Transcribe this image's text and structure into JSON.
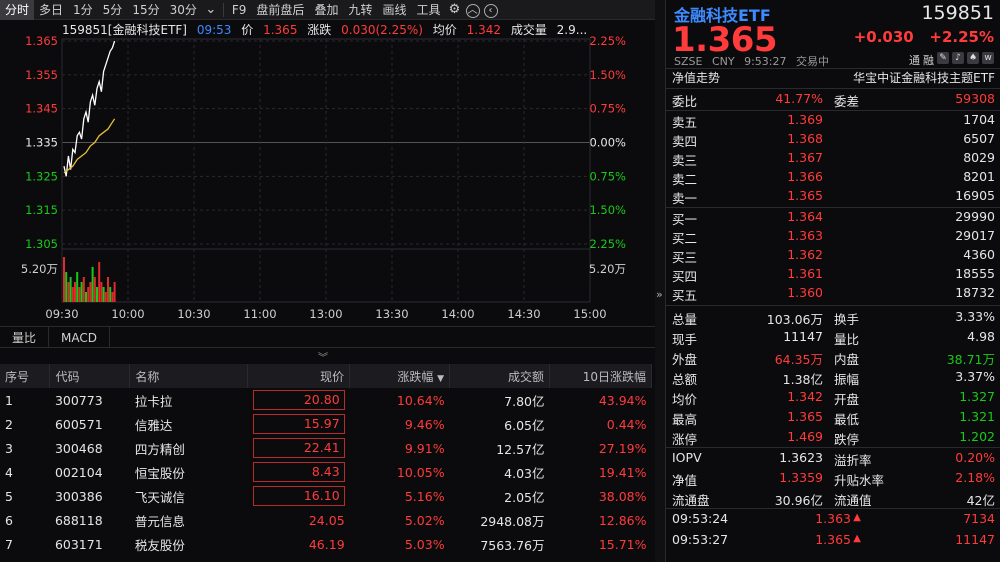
{
  "toolbar": {
    "left_tabs": [
      "分时",
      "多日",
      "1分",
      "5分",
      "15分",
      "30分"
    ],
    "right_tabs": [
      "F9",
      "盘前盘后",
      "叠加",
      "九转",
      "画线",
      "工具"
    ]
  },
  "chart_header": {
    "code_name": "159851[金融科技ETF]",
    "time": "09:53",
    "price_label": "价",
    "price": "1.365",
    "change_label": "涨跌",
    "change": "0.030(2.25%)",
    "avg_label": "均价",
    "avg": "1.342",
    "vol_label": "成交量",
    "vol": "2.9..."
  },
  "chart_data": {
    "type": "line",
    "x_ticks": [
      "09:30",
      "10:00",
      "10:30",
      "11:00",
      "13:00",
      "13:30",
      "14:00",
      "14:30",
      "15:00"
    ],
    "y_ticks_left": [
      "1.365",
      "1.355",
      "1.345",
      "1.335",
      "1.325",
      "1.315",
      "1.305"
    ],
    "y_ticks_right": [
      "2.25%",
      "1.50%",
      "0.75%",
      "0.00%",
      "0.75%",
      "1.50%",
      "2.25%"
    ],
    "ylim": [
      1.305,
      1.365
    ],
    "prev_close": 1.335,
    "volume_tick": "5.20万",
    "series": [
      {
        "name": "价",
        "color": "#ffffff",
        "x": [
          0,
          1,
          2,
          3,
          4,
          5,
          6,
          7,
          8,
          9,
          10,
          11,
          12,
          13,
          14,
          15,
          16,
          17,
          18,
          19,
          20,
          21,
          22,
          23
        ],
        "y": [
          1.328,
          1.325,
          1.331,
          1.327,
          1.333,
          1.332,
          1.337,
          1.338,
          1.336,
          1.342,
          1.344,
          1.341,
          1.347,
          1.349,
          1.346,
          1.351,
          1.353,
          1.35,
          1.356,
          1.358,
          1.36,
          1.362,
          1.363,
          1.365
        ]
      },
      {
        "name": "均价",
        "color": "#e8c13a",
        "x": [
          0,
          2,
          4,
          6,
          8,
          10,
          12,
          14,
          16,
          18,
          20,
          22,
          23
        ],
        "y": [
          1.326,
          1.327,
          1.328,
          1.33,
          1.331,
          1.332,
          1.334,
          1.335,
          1.337,
          1.338,
          1.339,
          1.341,
          1.342
        ]
      }
    ],
    "volume": [
      9,
      6,
      4,
      5,
      3,
      4,
      6,
      3,
      4,
      5,
      2,
      3,
      4,
      7,
      5,
      3,
      8,
      4,
      3,
      2,
      5,
      3,
      2,
      4
    ],
    "volume_colors": [
      "r",
      "g",
      "r",
      "g",
      "r",
      "r",
      "g",
      "r",
      "g",
      "r",
      "g",
      "r",
      "r",
      "g",
      "r",
      "g",
      "r",
      "r",
      "g",
      "r",
      "r",
      "g",
      "r",
      "r"
    ]
  },
  "subtabs": [
    "量比",
    "MACD"
  ],
  "table": {
    "headers": [
      "序号",
      "代码",
      "名称",
      "现价",
      "涨跌幅",
      "成交额",
      "10日涨跌幅"
    ],
    "rows": [
      {
        "no": "1",
        "code": "300773",
        "name": "拉卡拉",
        "price": "20.80",
        "chg": "10.64%",
        "amount": "7.80亿",
        "chg10": "43.94%",
        "boxed": true
      },
      {
        "no": "2",
        "code": "600571",
        "name": "信雅达",
        "price": "15.97",
        "chg": "9.46%",
        "amount": "6.05亿",
        "chg10": "0.44%",
        "boxed": true
      },
      {
        "no": "3",
        "code": "300468",
        "name": "四方精创",
        "price": "22.41",
        "chg": "9.91%",
        "amount": "12.57亿",
        "chg10": "27.19%",
        "boxed": true
      },
      {
        "no": "4",
        "code": "002104",
        "name": "恒宝股份",
        "price": "8.43",
        "chg": "10.05%",
        "amount": "4.03亿",
        "chg10": "19.41%",
        "boxed": true
      },
      {
        "no": "5",
        "code": "300386",
        "name": "飞天诚信",
        "price": "16.10",
        "chg": "5.16%",
        "amount": "2.05亿",
        "chg10": "38.08%",
        "boxed": true
      },
      {
        "no": "6",
        "code": "688118",
        "name": "普元信息",
        "price": "24.05",
        "chg": "5.02%",
        "amount": "2948.08万",
        "chg10": "12.86%",
        "boxed": false
      },
      {
        "no": "7",
        "code": "603171",
        "name": "税友股份",
        "price": "46.19",
        "chg": "5.03%",
        "amount": "7563.76万",
        "chg10": "15.71%",
        "boxed": false
      }
    ]
  },
  "quote": {
    "name": "金融科技ETF",
    "code": "159851",
    "price": "1.365",
    "change": "+0.030",
    "change_pct": "+2.25%",
    "market": "SZSE",
    "currency": "CNY",
    "time": "9:53:27",
    "status": "交易中",
    "tag1": "通",
    "tag2": "融",
    "nav_label": "净值走势",
    "fund_name": "华宝中证金融科技主题ETF",
    "weibi_label": "委比",
    "weibi": "41.77%",
    "weicha_label": "委差",
    "weicha": "59308",
    "asks": [
      {
        "label": "卖五",
        "price": "1.369",
        "vol": "1704"
      },
      {
        "label": "卖四",
        "price": "1.368",
        "vol": "6507"
      },
      {
        "label": "卖三",
        "price": "1.367",
        "vol": "8029"
      },
      {
        "label": "卖二",
        "price": "1.366",
        "vol": "8201"
      },
      {
        "label": "卖一",
        "price": "1.365",
        "vol": "16905"
      }
    ],
    "bids": [
      {
        "label": "买一",
        "price": "1.364",
        "vol": "29990"
      },
      {
        "label": "买二",
        "price": "1.363",
        "vol": "29017"
      },
      {
        "label": "买三",
        "price": "1.362",
        "vol": "4360"
      },
      {
        "label": "买四",
        "price": "1.361",
        "vol": "18555"
      },
      {
        "label": "买五",
        "price": "1.360",
        "vol": "18732"
      }
    ],
    "stats": [
      {
        "l1": "总量",
        "v1": "103.06万",
        "c1": "white",
        "l2": "换手",
        "v2": "3.33%",
        "c2": "white"
      },
      {
        "l1": "现手",
        "v1": "11147",
        "c1": "white",
        "l2": "量比",
        "v2": "4.98",
        "c2": "white"
      },
      {
        "l1": "外盘",
        "v1": "64.35万",
        "c1": "red",
        "l2": "内盘",
        "v2": "38.71万",
        "c2": "green"
      },
      {
        "l1": "总额",
        "v1": "1.38亿",
        "c1": "white",
        "l2": "振幅",
        "v2": "3.37%",
        "c2": "white"
      },
      {
        "l1": "均价",
        "v1": "1.342",
        "c1": "red",
        "l2": "开盘",
        "v2": "1.327",
        "c2": "green"
      },
      {
        "l1": "最高",
        "v1": "1.365",
        "c1": "red",
        "l2": "最低",
        "v2": "1.321",
        "c2": "green"
      },
      {
        "l1": "涨停",
        "v1": "1.469",
        "c1": "red",
        "l2": "跌停",
        "v2": "1.202",
        "c2": "green"
      }
    ],
    "stats2": [
      {
        "l1": "IOPV",
        "v1": "1.3623",
        "c1": "white",
        "l2": "溢折率",
        "v2": "0.20%",
        "c2": "red"
      },
      {
        "l1": "净值",
        "v1": "1.3359",
        "c1": "red",
        "l2": "升贴水率",
        "v2": "2.18%",
        "c2": "red"
      },
      {
        "l1": "流通盘",
        "v1": "30.96亿",
        "c1": "white",
        "l2": "流通值",
        "v2": "42亿",
        "c2": "white"
      }
    ],
    "ticks": [
      {
        "time": "09:53:24",
        "price": "1.363",
        "vol": "7134"
      },
      {
        "time": "09:53:27",
        "price": "1.365",
        "vol": "11147"
      }
    ]
  }
}
